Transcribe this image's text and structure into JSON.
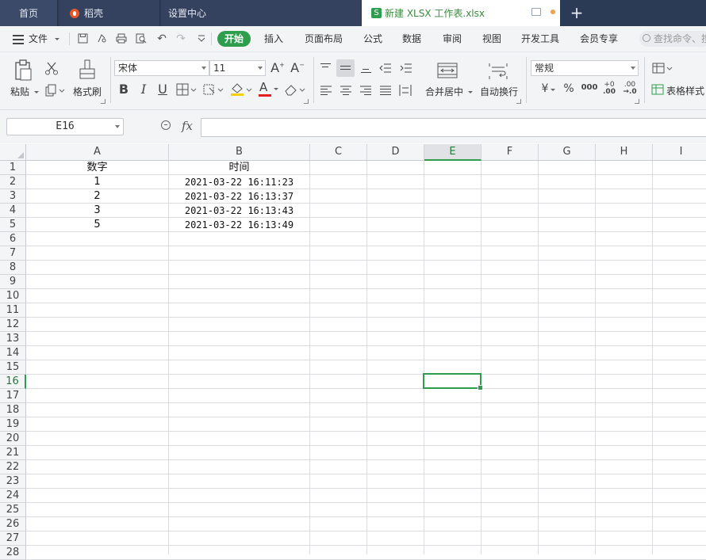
{
  "tabs": {
    "home": "首页",
    "dochub": "稻壳",
    "settings": "设置中心",
    "active_file": "新建 XLSX 工作表.xlsx",
    "active_icon": "S",
    "new_tab": "+"
  },
  "menu": {
    "file": "文件",
    "items": [
      "开始",
      "插入",
      "页面布局",
      "公式",
      "数据",
      "审阅",
      "视图",
      "开发工具",
      "会员专享"
    ],
    "active": "开始",
    "search_placeholder": "查找命令、搜"
  },
  "ribbon": {
    "paste": "粘贴",
    "format_painter": "格式刷",
    "font_name": "宋体",
    "font_size": "11",
    "increase_font": "A",
    "decrease_font": "A",
    "bold": "B",
    "italic": "I",
    "underline": "U",
    "font_color": "A",
    "merge_center": "合并居中",
    "wrap_text": "自动换行",
    "number_format": "常规",
    "currency": "¥",
    "percent": "%",
    "thousands": "000",
    "inc_decimal": "+0",
    "dec_decimal": ".00",
    "table_style": "表格样式"
  },
  "formula_bar": {
    "name_box": "E16",
    "fx": "fx",
    "formula": ""
  },
  "sheet": {
    "columns": [
      "A",
      "B",
      "C",
      "D",
      "E",
      "F",
      "G",
      "H",
      "I"
    ],
    "selected_column": "E",
    "selected_row": 16,
    "rows": [
      "1",
      "2",
      "3",
      "4",
      "5",
      "6",
      "7",
      "8",
      "9",
      "10",
      "11",
      "12",
      "13",
      "14",
      "15",
      "16",
      "17",
      "18",
      "19",
      "20",
      "21",
      "22",
      "23",
      "24",
      "25",
      "26",
      "27",
      "28"
    ],
    "header": [
      "数字",
      "时间"
    ],
    "data": [
      [
        "1",
        "2021-03-22 16:11:23"
      ],
      [
        "2",
        "2021-03-22 16:13:37"
      ],
      [
        "3",
        "2021-03-22 16:13:43"
      ],
      [
        "5",
        "2021-03-22 16:13:49"
      ]
    ]
  },
  "colors": {
    "accent": "#2e9e4e",
    "tabbar": "#2b3a55",
    "ribbon_bg": "#f3f4f6"
  }
}
